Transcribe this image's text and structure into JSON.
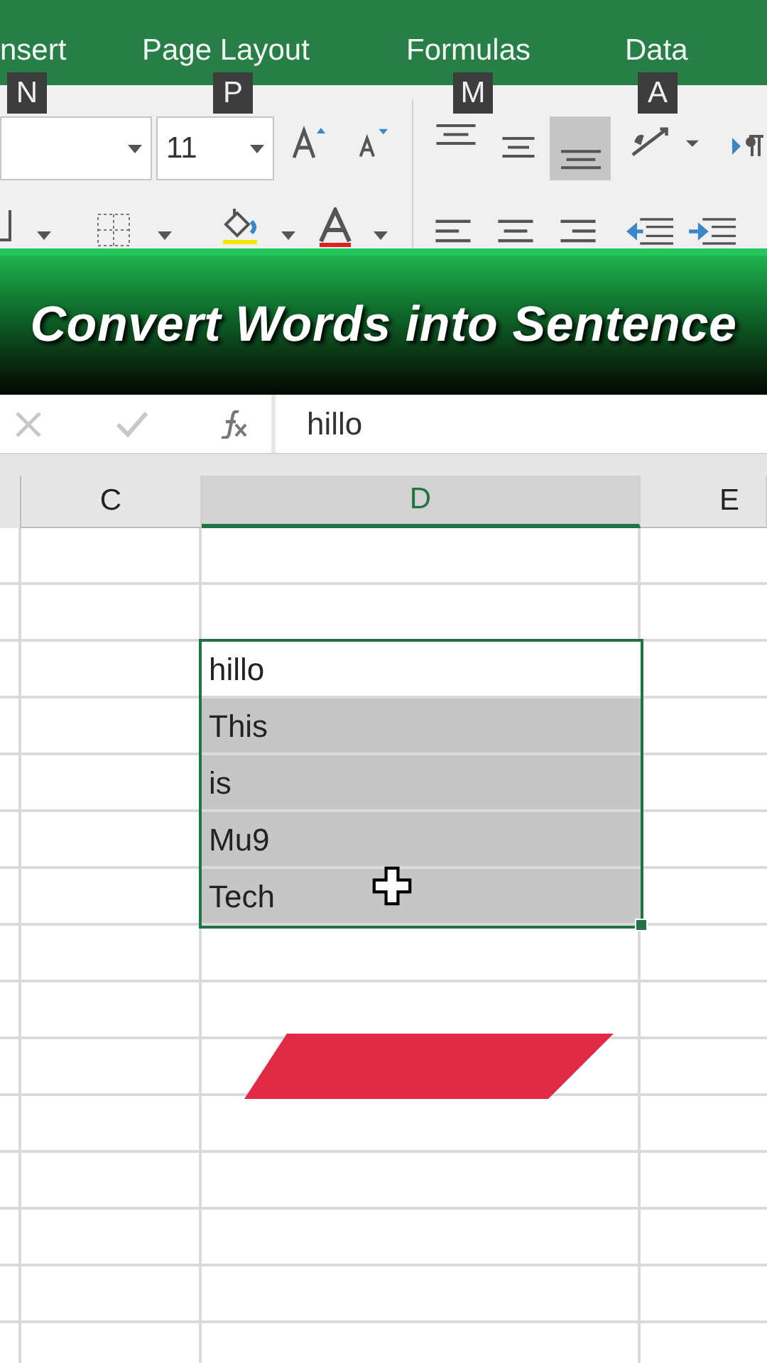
{
  "ribbon_tabs": [
    {
      "label": "nsert",
      "keytip": "N"
    },
    {
      "label": "Page Layout",
      "keytip": "P"
    },
    {
      "label": "Formulas",
      "keytip": "M"
    },
    {
      "label": "Data",
      "keytip": "A"
    }
  ],
  "font_size": "11",
  "banner": {
    "title": "Convert Words into Sentence"
  },
  "formula_bar": {
    "value": "hillo"
  },
  "columns": [
    {
      "label": "C",
      "selected": false
    },
    {
      "label": "D",
      "selected": true
    },
    {
      "label": "E",
      "selected": false
    }
  ],
  "cells": [
    {
      "text": "hillo",
      "active": true
    },
    {
      "text": "This",
      "active": false
    },
    {
      "text": "is",
      "active": false
    },
    {
      "text": "Mu9",
      "active": false
    },
    {
      "text": "Tech",
      "active": false
    }
  ]
}
